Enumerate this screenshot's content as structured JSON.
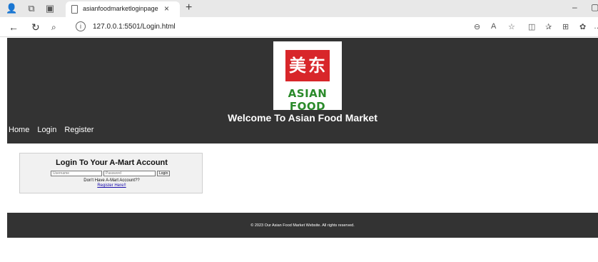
{
  "browser": {
    "tab_title": "asianfoodmarketloginpage",
    "tab_close": "×",
    "new_tab": "+",
    "url": "127.0.0.1:5501/Login.html",
    "minimize": "–",
    "icons": [
      "profile-icon",
      "workspaces-icon",
      "tab-actions-icon",
      "back-icon",
      "refresh-icon",
      "search-icon",
      "info-icon",
      "zoom-icon",
      "read-aloud-icon",
      "favorite-icon",
      "split-screen-icon",
      "favorites-icon",
      "collections-icon",
      "copilot-icon",
      "more-icon"
    ]
  },
  "header": {
    "logo_glyphs": [
      "美",
      "东"
    ],
    "logo_brand": "ASIAN FOOD",
    "welcome": "Welcome To Asian Food Market",
    "nav": {
      "home": "Home",
      "login": "Login",
      "register": "Register"
    }
  },
  "login": {
    "heading": "Login To Your A-Mart Account",
    "username_placeholder": "Username",
    "password_placeholder": "Password",
    "submit_label": "Login",
    "hint": "Don't Have A-Mart Account??",
    "register_link": "Register Here!!"
  },
  "footer": {
    "copyright": "© 2023 Our Asian Food Market Website. All rights reserved."
  },
  "colors": {
    "header_bg": "#333333",
    "logo_red": "#d8262a",
    "logo_green": "#2a8a2a",
    "link_blue": "#1a0dab"
  }
}
